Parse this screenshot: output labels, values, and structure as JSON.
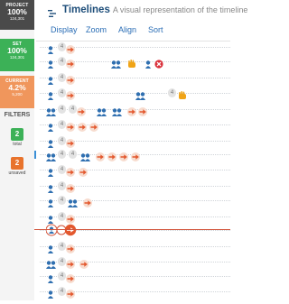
{
  "sidebar": {
    "project": {
      "label": "PROJECT",
      "percent": "100%",
      "count": "124,301"
    },
    "set": {
      "label": "SET",
      "percent": "100%",
      "count": "124,301"
    },
    "current": {
      "label": "CURRENT",
      "percent": "4.2%",
      "count": "5,200"
    },
    "filters_title": "FILTERS",
    "total": {
      "value": "2",
      "label": "total"
    },
    "unsaved": {
      "value": "2",
      "label": "unsaved"
    }
  },
  "header": {
    "title": "Timelines",
    "subtitle": "A visual representation of the timeline"
  },
  "menu": [
    "Display",
    "Zoom",
    "Align",
    "Sort"
  ],
  "timeline_badge": "4",
  "colors": {
    "user_icon": "#2f6fb0",
    "arrow": "#e3582e",
    "hand_icon": "#f0a417",
    "error_icon": "#d9303a",
    "highlight_line": "#d2533a"
  }
}
